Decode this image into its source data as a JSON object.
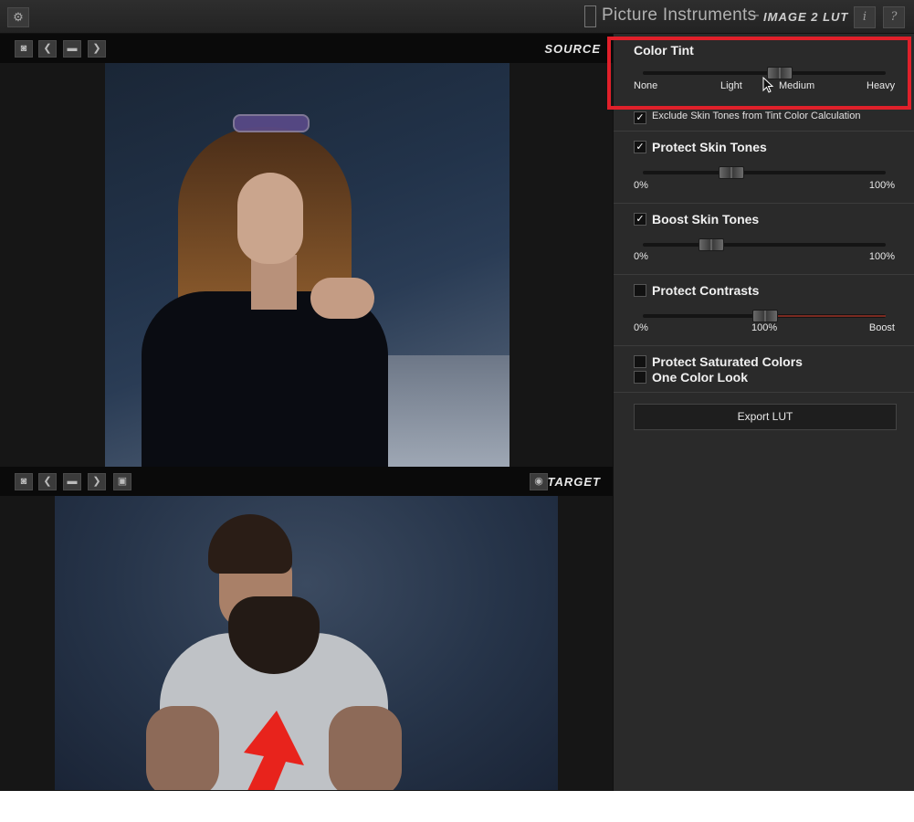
{
  "titlebar": {
    "brand": "Picture Instruments",
    "separator": "–",
    "product": "IMAGE 2 LUT",
    "info_label": "i",
    "help_label": "?"
  },
  "source": {
    "label": "SOURCE"
  },
  "target": {
    "label": "TARGET"
  },
  "panel": {
    "color_tint": {
      "title": "Color Tint",
      "ticks": [
        "None",
        "Light",
        "Medium",
        "Heavy"
      ],
      "value": 0.56,
      "exclude_label": "Exclude Skin Tones from Tint Color Calculation",
      "exclude_checked": true
    },
    "protect_skin": {
      "title": "Protect Skin Tones",
      "checked": true,
      "min": "0%",
      "max": "100%",
      "value": 0.36
    },
    "boost_skin": {
      "title": "Boost Skin Tones",
      "checked": true,
      "min": "0%",
      "max": "100%",
      "value": 0.28
    },
    "protect_contrasts": {
      "title": "Protect Contrasts",
      "checked": false,
      "min": "0%",
      "mid": "100%",
      "max": "Boost",
      "value": 0.5
    },
    "protect_saturated": {
      "title": "Protect Saturated Colors",
      "checked": false
    },
    "one_color_look": {
      "title": "One Color Look",
      "checked": false
    },
    "export_label": "Export LUT"
  },
  "colors": {
    "highlight": "#e0202a",
    "arrow": "#e8231c",
    "panel_bg": "#2a2a2a"
  },
  "icons": [
    "gear-icon",
    "snapshot-icon",
    "chevron-left-icon",
    "folder-icon",
    "chevron-right-icon",
    "save-icon",
    "eye-icon",
    "cursor-icon",
    "arrow-icon"
  ]
}
